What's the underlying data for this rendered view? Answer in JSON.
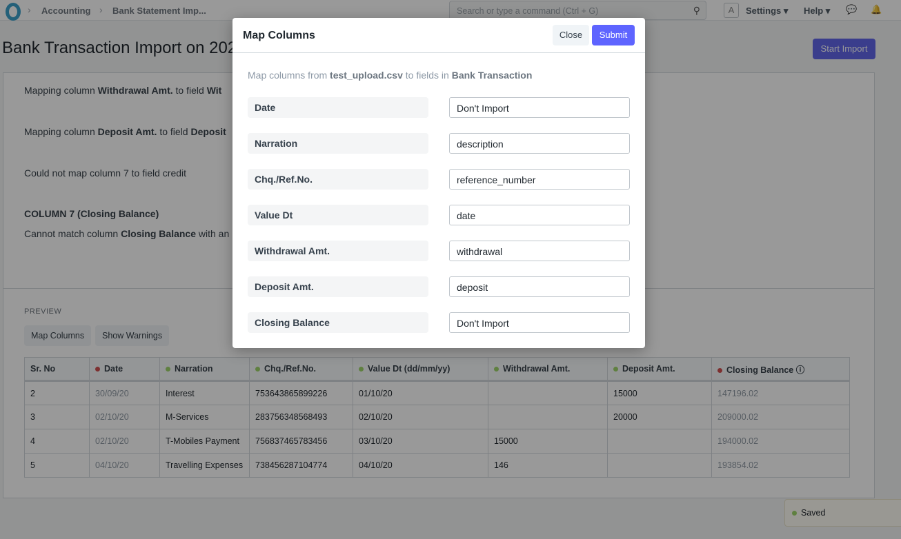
{
  "nav": {
    "breadcrumbs": [
      "Accounting",
      "Bank Statement Imp..."
    ],
    "search_placeholder": "Search or type a command (Ctrl + G)",
    "avatar": "A",
    "settings": "Settings",
    "help": "Help"
  },
  "page": {
    "title": "Bank Transaction Import on 202",
    "start_import": "Start Import"
  },
  "messages": [
    {
      "pre": "Mapping column ",
      "b1": "Withdrawal Amt.",
      "mid": " to field ",
      "b2": "Wit"
    },
    {
      "pre": "Mapping column ",
      "b1": "Deposit Amt.",
      "mid": " to field ",
      "b2": "Deposit"
    },
    {
      "pre": "Could not map column 7 to field credit"
    },
    {
      "heading": "COLUMN 7 (Closing Balance)"
    },
    {
      "pre": "Cannot match column ",
      "b1": "Closing Balance",
      "mid": " with an"
    }
  ],
  "preview": {
    "label": "PREVIEW",
    "map_columns": "Map Columns",
    "show_warnings": "Show Warnings",
    "columns": [
      {
        "name": "Sr. No",
        "status": ""
      },
      {
        "name": "Date",
        "status": "error"
      },
      {
        "name": "Narration",
        "status": "ok"
      },
      {
        "name": "Chq./Ref.No.",
        "status": "ok"
      },
      {
        "name": "Value Dt (dd/mm/yy)",
        "status": "ok"
      },
      {
        "name": "Withdrawal Amt.",
        "status": "ok"
      },
      {
        "name": "Deposit Amt.",
        "status": "ok"
      },
      {
        "name": "Closing Balance",
        "status": "error"
      }
    ],
    "rows": [
      [
        "2",
        "30/09/20",
        "Interest",
        "753643865899226",
        "01/10/20",
        "",
        "15000",
        "147196.02"
      ],
      [
        "3",
        "02/10/20",
        "M-Services",
        "283756348568493",
        "02/10/20",
        "",
        "20000",
        "209000.02"
      ],
      [
        "4",
        "02/10/20",
        "T-Mobiles Payment",
        "756837465783456",
        "03/10/20",
        "15000",
        "",
        "194000.02"
      ],
      [
        "5",
        "04/10/20",
        "Travelling Expenses",
        "738456287104774",
        "04/10/20",
        "146",
        "",
        "193854.02"
      ]
    ]
  },
  "toast": {
    "text": "Saved"
  },
  "modal": {
    "title": "Map Columns",
    "close": "Close",
    "submit": "Submit",
    "desc_pre": "Map columns from ",
    "file": "test_upload.csv",
    "desc_mid": " to fields in ",
    "doctype": "Bank Transaction",
    "fields": [
      {
        "label": "Date",
        "value": "Don't Import"
      },
      {
        "label": "Narration",
        "value": "description"
      },
      {
        "label": "Chq./Ref.No.",
        "value": "reference_number"
      },
      {
        "label": "Value Dt",
        "value": "date"
      },
      {
        "label": "Withdrawal Amt.",
        "value": "withdrawal"
      },
      {
        "label": "Deposit Amt.",
        "value": "deposit"
      },
      {
        "label": "Closing Balance",
        "value": "Don't Import"
      }
    ]
  },
  "colors": {
    "primary": "#5e64ff",
    "error": "#e24c4c",
    "ok": "#98d85b"
  }
}
